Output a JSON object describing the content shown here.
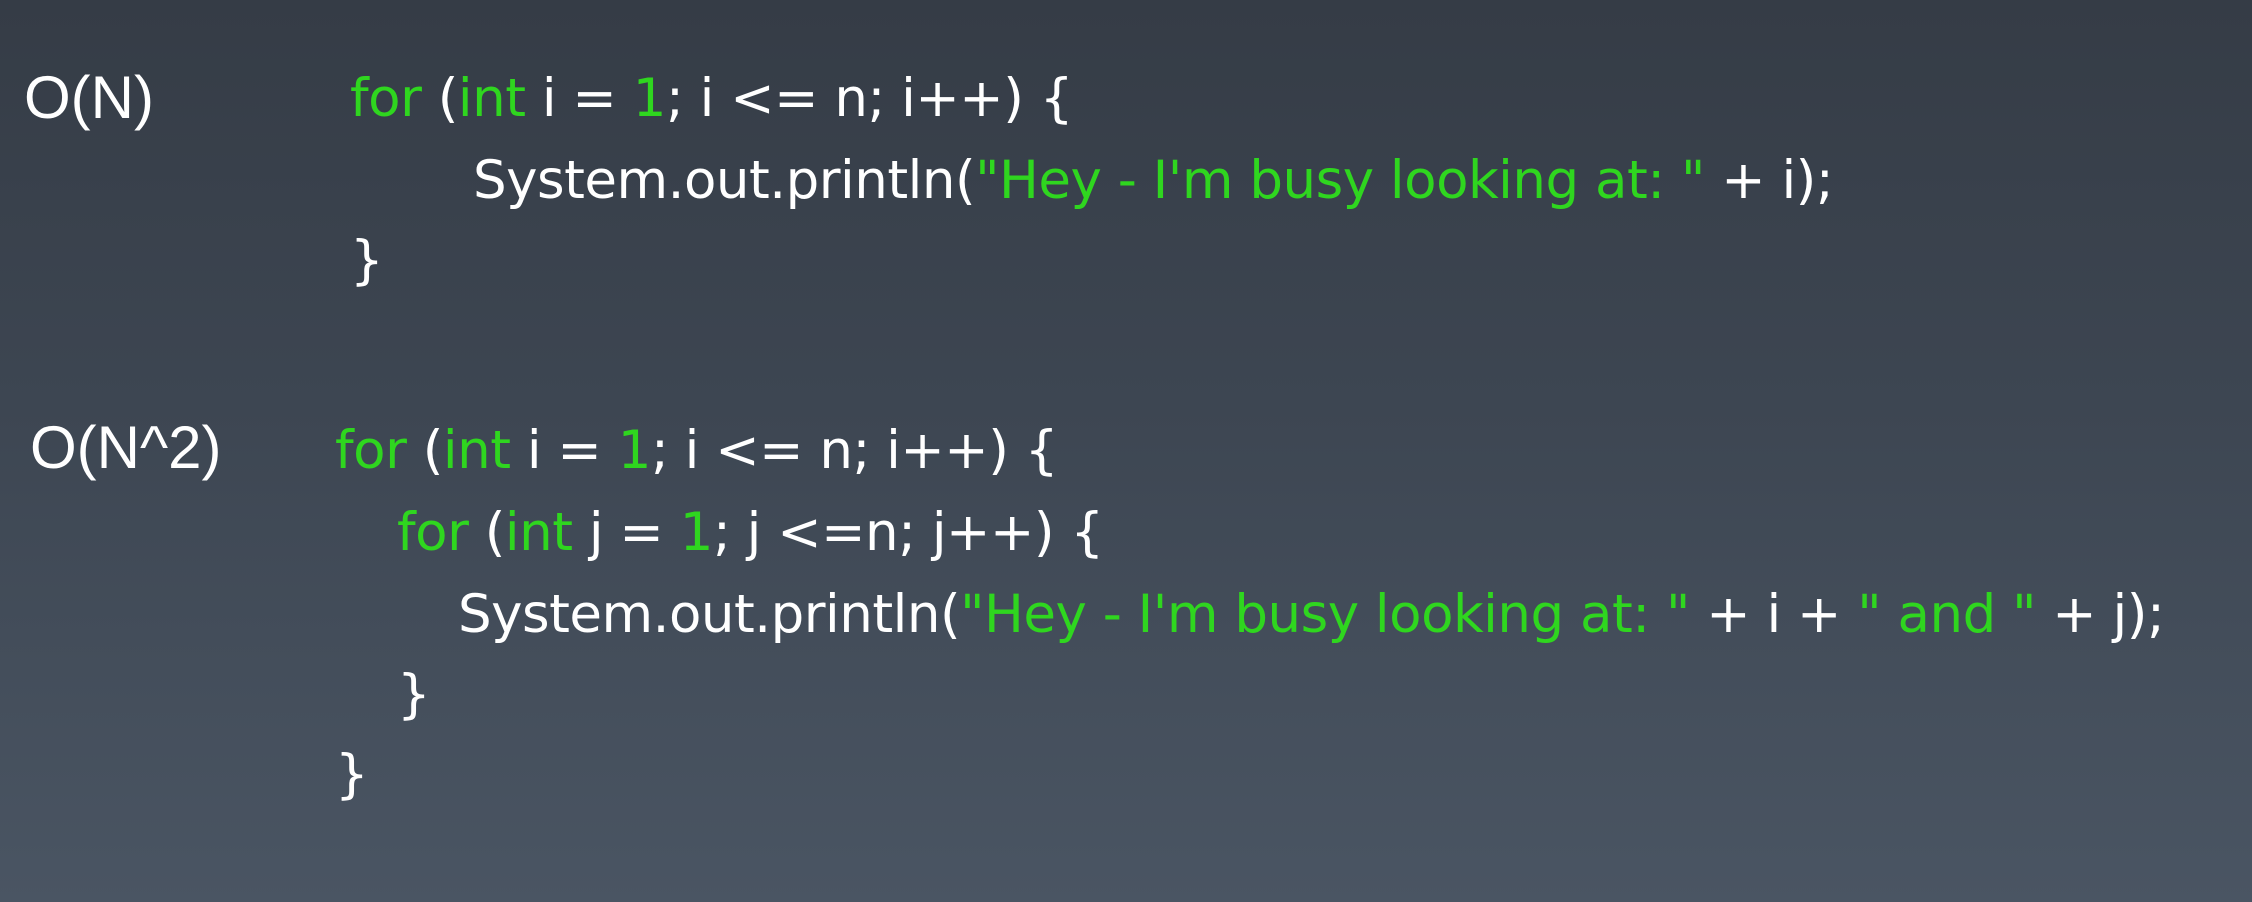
{
  "labels": {
    "linear": "O(N)",
    "quadratic": "O(N^2)"
  },
  "colors": {
    "background_top": "#353c46",
    "background_bottom": "#4a5563",
    "text": "#ffffff",
    "syntax_green": "#2fd61f"
  },
  "code_linear": [
    [
      {
        "t": "for",
        "c": "kw"
      },
      {
        "t": " (",
        "c": "plain"
      },
      {
        "t": "int",
        "c": "kw"
      },
      {
        "t": " i = ",
        "c": "plain"
      },
      {
        "t": "1",
        "c": "num"
      },
      {
        "t": "; i <= n; i++) {",
        "c": "plain"
      }
    ],
    [
      {
        "t": "System.out.println(",
        "c": "plain"
      },
      {
        "t": "\"Hey - I'm busy looking at: \"",
        "c": "str"
      },
      {
        "t": " + i);",
        "c": "plain"
      }
    ],
    [
      {
        "t": "}",
        "c": "plain"
      }
    ]
  ],
  "code_quadratic": [
    [
      {
        "t": "for",
        "c": "kw"
      },
      {
        "t": " (",
        "c": "plain"
      },
      {
        "t": "int",
        "c": "kw"
      },
      {
        "t": " i = ",
        "c": "plain"
      },
      {
        "t": "1",
        "c": "num"
      },
      {
        "t": "; i <= n; i++) {",
        "c": "plain"
      }
    ],
    [
      {
        "t": "for",
        "c": "kw"
      },
      {
        "t": " (",
        "c": "plain"
      },
      {
        "t": "int",
        "c": "kw"
      },
      {
        "t": " j = ",
        "c": "plain"
      },
      {
        "t": "1",
        "c": "num"
      },
      {
        "t": "; j <=n; j++) {",
        "c": "plain"
      }
    ],
    [
      {
        "t": "System.out.println(",
        "c": "plain"
      },
      {
        "t": "\"Hey - I'm busy looking at: \"",
        "c": "str"
      },
      {
        "t": " + i + ",
        "c": "plain"
      },
      {
        "t": "\" and \"",
        "c": "str"
      },
      {
        "t": " + j);",
        "c": "plain"
      }
    ],
    [
      {
        "t": "}",
        "c": "plain"
      }
    ],
    [
      {
        "t": "}",
        "c": "plain"
      }
    ]
  ]
}
